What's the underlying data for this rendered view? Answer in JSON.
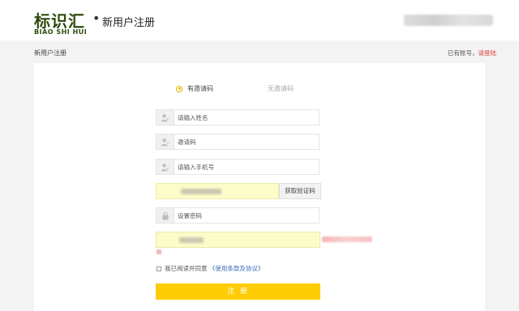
{
  "header": {
    "logo_cn": "标识汇",
    "logo_en": "BIAO SHI HUI",
    "separator": "•",
    "page_heading": "新用户注册"
  },
  "subbar": {
    "title": "新用户注册",
    "have_account": "已有账号，",
    "login_link": "请登陆"
  },
  "tabs": [
    {
      "label": "有邀请码",
      "selected": true
    },
    {
      "label": "无邀请码",
      "selected": false
    }
  ],
  "fields": {
    "name_placeholder": "请输入姓名",
    "invite_placeholder": "邀请码",
    "phone_placeholder": "请输入手机号",
    "password_placeholder": "设置密码"
  },
  "code_button": "获取验证码",
  "agreement": {
    "prefix": "我已阅读并同意",
    "terms": "《使用条款及协议》"
  },
  "submit_label": "注 册",
  "colors": {
    "accent": "#ffcc05",
    "link_red": "#e0403a",
    "link_blue": "#3a6db5",
    "autofill": "#fbfcc8"
  },
  "icons": {
    "name": "user-icon",
    "invite": "user-icon",
    "phone": "user-icon",
    "password": "lock-icon"
  }
}
